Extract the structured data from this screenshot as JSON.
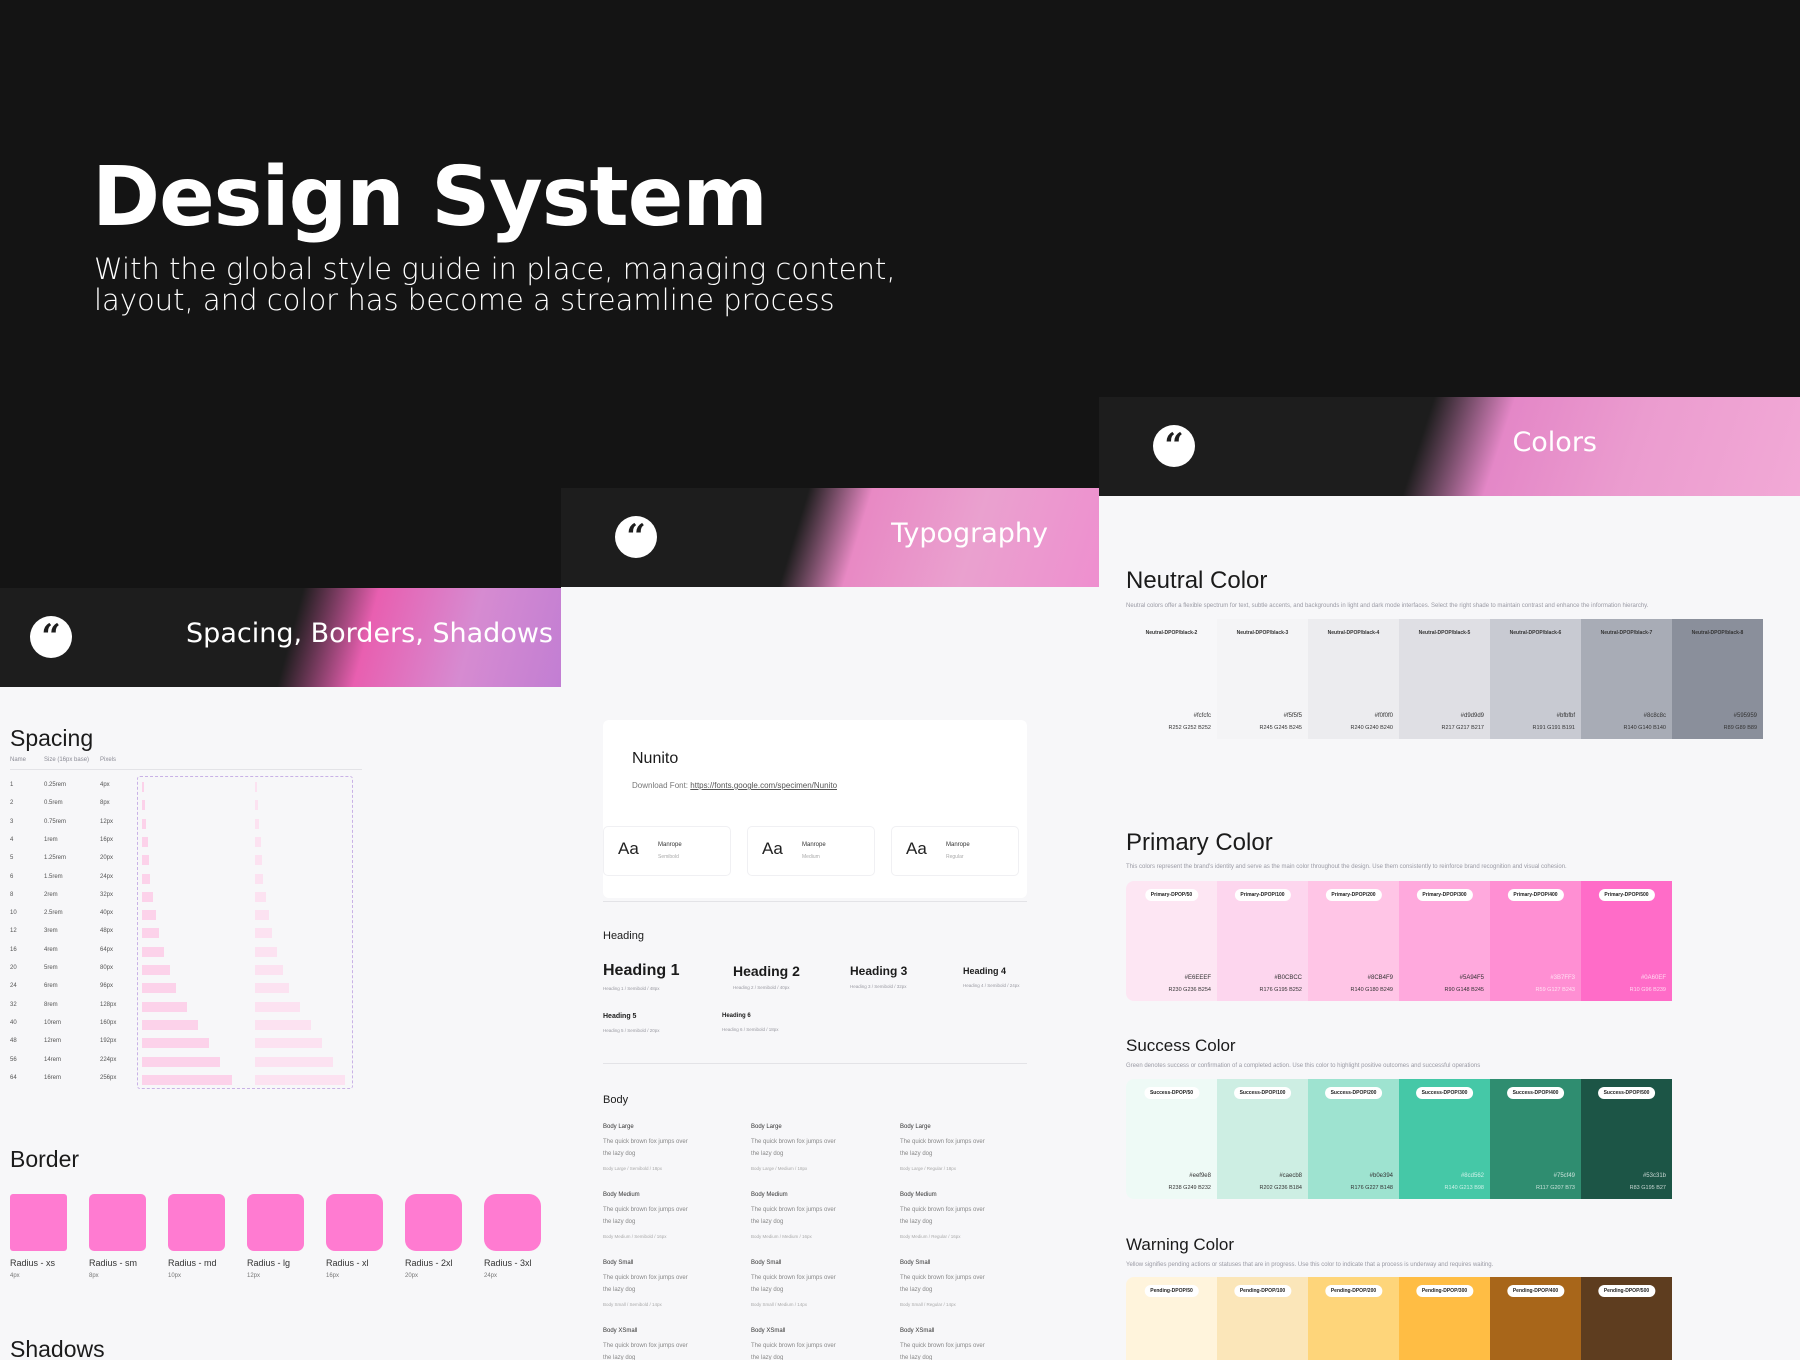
{
  "hero": {
    "title": "Design System",
    "subtitle": "With the global style guide in place, managing content, layout, and color has become a streamline process"
  },
  "panels": {
    "spacing": {
      "banner": "Spacing, Borders, Shadows",
      "spacing_title": "Spacing",
      "columns": [
        "Name",
        "Size (16px base)",
        "Pixels"
      ],
      "rows": [
        {
          "name": "1",
          "rem": "0.25rem",
          "px": "4px"
        },
        {
          "name": "2",
          "rem": "0.5rem",
          "px": "8px"
        },
        {
          "name": "3",
          "rem": "0.75rem",
          "px": "12px"
        },
        {
          "name": "4",
          "rem": "1rem",
          "px": "16px"
        },
        {
          "name": "5",
          "rem": "1.25rem",
          "px": "20px"
        },
        {
          "name": "6",
          "rem": "1.5rem",
          "px": "24px"
        },
        {
          "name": "8",
          "rem": "2rem",
          "px": "32px"
        },
        {
          "name": "10",
          "rem": "2.5rem",
          "px": "40px"
        },
        {
          "name": "12",
          "rem": "3rem",
          "px": "48px"
        },
        {
          "name": "16",
          "rem": "4rem",
          "px": "64px"
        },
        {
          "name": "20",
          "rem": "5rem",
          "px": "80px"
        },
        {
          "name": "24",
          "rem": "6rem",
          "px": "96px"
        },
        {
          "name": "32",
          "rem": "8rem",
          "px": "128px"
        },
        {
          "name": "40",
          "rem": "10rem",
          "px": "160px"
        },
        {
          "name": "48",
          "rem": "12rem",
          "px": "192px"
        },
        {
          "name": "56",
          "rem": "14rem",
          "px": "224px"
        },
        {
          "name": "64",
          "rem": "16rem",
          "px": "256px"
        }
      ],
      "border_title": "Border",
      "radii": [
        {
          "label": "Radius - xs",
          "px": "4px"
        },
        {
          "label": "Radius - sm",
          "px": "8px"
        },
        {
          "label": "Radius - md",
          "px": "10px"
        },
        {
          "label": "Radius - lg",
          "px": "12px"
        },
        {
          "label": "Radius - xl",
          "px": "16px"
        },
        {
          "label": "Radius - 2xl",
          "px": "20px"
        },
        {
          "label": "Radius - 3xl",
          "px": "24px"
        }
      ],
      "shadows_title": "Shadows"
    },
    "typography": {
      "banner": "Typography",
      "font_name": "Nunito",
      "download_label": "Download Font:",
      "download_url": "https://fonts.google.com/specimen/Nunito",
      "samples": [
        {
          "aa": "Aa",
          "font": "Manrope",
          "weight": "Semibold"
        },
        {
          "aa": "Aa",
          "font": "Manrope",
          "weight": "Medium"
        },
        {
          "aa": "Aa",
          "font": "Manrope",
          "weight": "Regular"
        }
      ],
      "heading_section": "Heading",
      "headings": [
        {
          "label": "Heading 1",
          "cap": "Heading 1 / Semibold / 48px"
        },
        {
          "label": "Heading 2",
          "cap": "Heading 2 / Semibold / 40px"
        },
        {
          "label": "Heading 3",
          "cap": "Heading 3 / Semibold / 32px"
        },
        {
          "label": "Heading 4",
          "cap": "Heading 4 / Semibold / 24px"
        },
        {
          "label": "Heading 5",
          "cap": "Heading 5 / Semibold / 20px"
        },
        {
          "label": "Heading 6",
          "cap": "Heading 6 / Semibold / 18px"
        }
      ],
      "body_section": "Body",
      "body_rows": [
        {
          "label": "Body Large",
          "text": "The quick brown fox jumps over the lazy dog",
          "caps": [
            "Body Large / Semibold / 18px",
            "Body Large / Medium / 18px",
            "Body Large / Regular / 18px"
          ]
        },
        {
          "label": "Body Medium",
          "text": "The quick brown fox jumps over the lazy dog",
          "caps": [
            "Body Medium / Semibold / 16px",
            "Body Medium / Medium / 16px",
            "Body Medium / Regular / 16px"
          ]
        },
        {
          "label": "Body Small",
          "text": "The quick brown fox jumps over the lazy dog",
          "caps": [
            "Body Small / Semibold / 14px",
            "Body Small / Medium / 14px",
            "Body Small / Regular / 14px"
          ]
        },
        {
          "label": "Body XSmall",
          "text": "The quick brown fox jumps over the lazy dog",
          "caps": [
            "",
            "",
            ""
          ]
        }
      ]
    },
    "colors": {
      "banner": "Colors",
      "neutral": {
        "title": "Neutral Color",
        "desc": "Neutral colors offer a flexible spectrum for text, subtle accents, and backgrounds in light and dark mode interfaces. Select the right shade to maintain contrast and enhance the information hierarchy.",
        "swatches": [
          {
            "name": "Neutral-DPOP/black-2",
            "hex": "#fcfcfc",
            "rgb": "R252 G252 B252",
            "color": "#f7f7f9"
          },
          {
            "name": "Neutral-DPOP/black-3",
            "hex": "#f5f5f5",
            "rgb": "R245 G245 B245",
            "color": "#f4f4f6"
          },
          {
            "name": "Neutral-DPOP/black-4",
            "hex": "#f0f0f0",
            "rgb": "R240 G240 B240",
            "color": "#ececef"
          },
          {
            "name": "Neutral-DPOP/black-5",
            "hex": "#d9d9d9",
            "rgb": "R217 G217 B217",
            "color": "#dfdfe4"
          },
          {
            "name": "Neutral-DPOP/black-6",
            "hex": "#bfbfbf",
            "rgb": "R191 G191 B191",
            "color": "#c8cad2"
          },
          {
            "name": "Neutral-DPOP/black-7",
            "hex": "#8c8c8c",
            "rgb": "R140 G140 B140",
            "color": "#a8acb6"
          },
          {
            "name": "Neutral-DPOP/black-8",
            "hex": "#595959",
            "rgb": "R89 G89 B89",
            "color": "#8a8f9b"
          }
        ]
      },
      "primary": {
        "title": "Primary Color",
        "desc": "This colors represent the brand's identity and serve as the main color throughout the design. Use them consistently to reinforce brand recognition and visual cohesion.",
        "swatches": [
          {
            "name": "Primary-DPOP/50",
            "hex": "#E6EEEF",
            "rgb": "R230 G236 B254",
            "color": "#fde6f3"
          },
          {
            "name": "Primary-DPOP/100",
            "hex": "#B0CBCC",
            "rgb": "R176 G195 B252",
            "color": "#fdd6ee"
          },
          {
            "name": "Primary-DPOP/200",
            "hex": "#8CB4F9",
            "rgb": "R140 G180 B249",
            "color": "#ffc5e6"
          },
          {
            "name": "Primary-DPOP/300",
            "hex": "#5A94F5",
            "rgb": "R90 G148 B245",
            "color": "#ffa9dd"
          },
          {
            "name": "Primary-DPOP/400",
            "hex": "#3B7FF3",
            "rgb": "R59 G127 B243",
            "color": "#ff8fd3"
          },
          {
            "name": "Primary-DPOP/500",
            "hex": "#0A60EF",
            "rgb": "R10 G96 B239",
            "color": "#ff6cc8"
          }
        ]
      },
      "success": {
        "title": "Success Color",
        "desc": "Green denotes success or confirmation of a completed action. Use this color to highlight positive outcomes and successful operations",
        "swatches": [
          {
            "name": "Success-DPOP/50",
            "hex": "#eef9e8",
            "rgb": "R238 G249 B232",
            "color": "#eefaf6"
          },
          {
            "name": "Success-DPOP/100",
            "hex": "#caecb8",
            "rgb": "R202 G236 B184",
            "color": "#cdeee3"
          },
          {
            "name": "Success-DPOP/200",
            "hex": "#b0e394",
            "rgb": "R176 G227 B148",
            "color": "#9ee3d0"
          },
          {
            "name": "Success-DPOP/300",
            "hex": "#8cd562",
            "rgb": "R140 G213 B98",
            "color": "#45c8a7"
          },
          {
            "name": "Success-DPOP/400",
            "hex": "#75cf49",
            "rgb": "R117 G207 B73",
            "color": "#2f8d70"
          },
          {
            "name": "Success-DPOP/500",
            "hex": "#53c31b",
            "rgb": "R83 G195 B27",
            "color": "#1c5546"
          }
        ]
      },
      "warning": {
        "title": "Warning Color",
        "desc": "Yellow signifies pending actions or statuses that are in progress. Use this color to indicate that a process is underway and requires waiting.",
        "swatches": [
          {
            "name": "Pending-DPOP/50",
            "color": "#fff4dc"
          },
          {
            "name": "Pending-DPOP/100",
            "color": "#fbe6b9"
          },
          {
            "name": "Pending-DPOP/200",
            "color": "#fed57a"
          },
          {
            "name": "Pending-DPOP/300",
            "color": "#ffbd44"
          },
          {
            "name": "Pending-DPOP/400",
            "color": "#a8661a"
          },
          {
            "name": "Pending-DPOP/500",
            "color": "#5e3d1f"
          }
        ]
      }
    }
  }
}
